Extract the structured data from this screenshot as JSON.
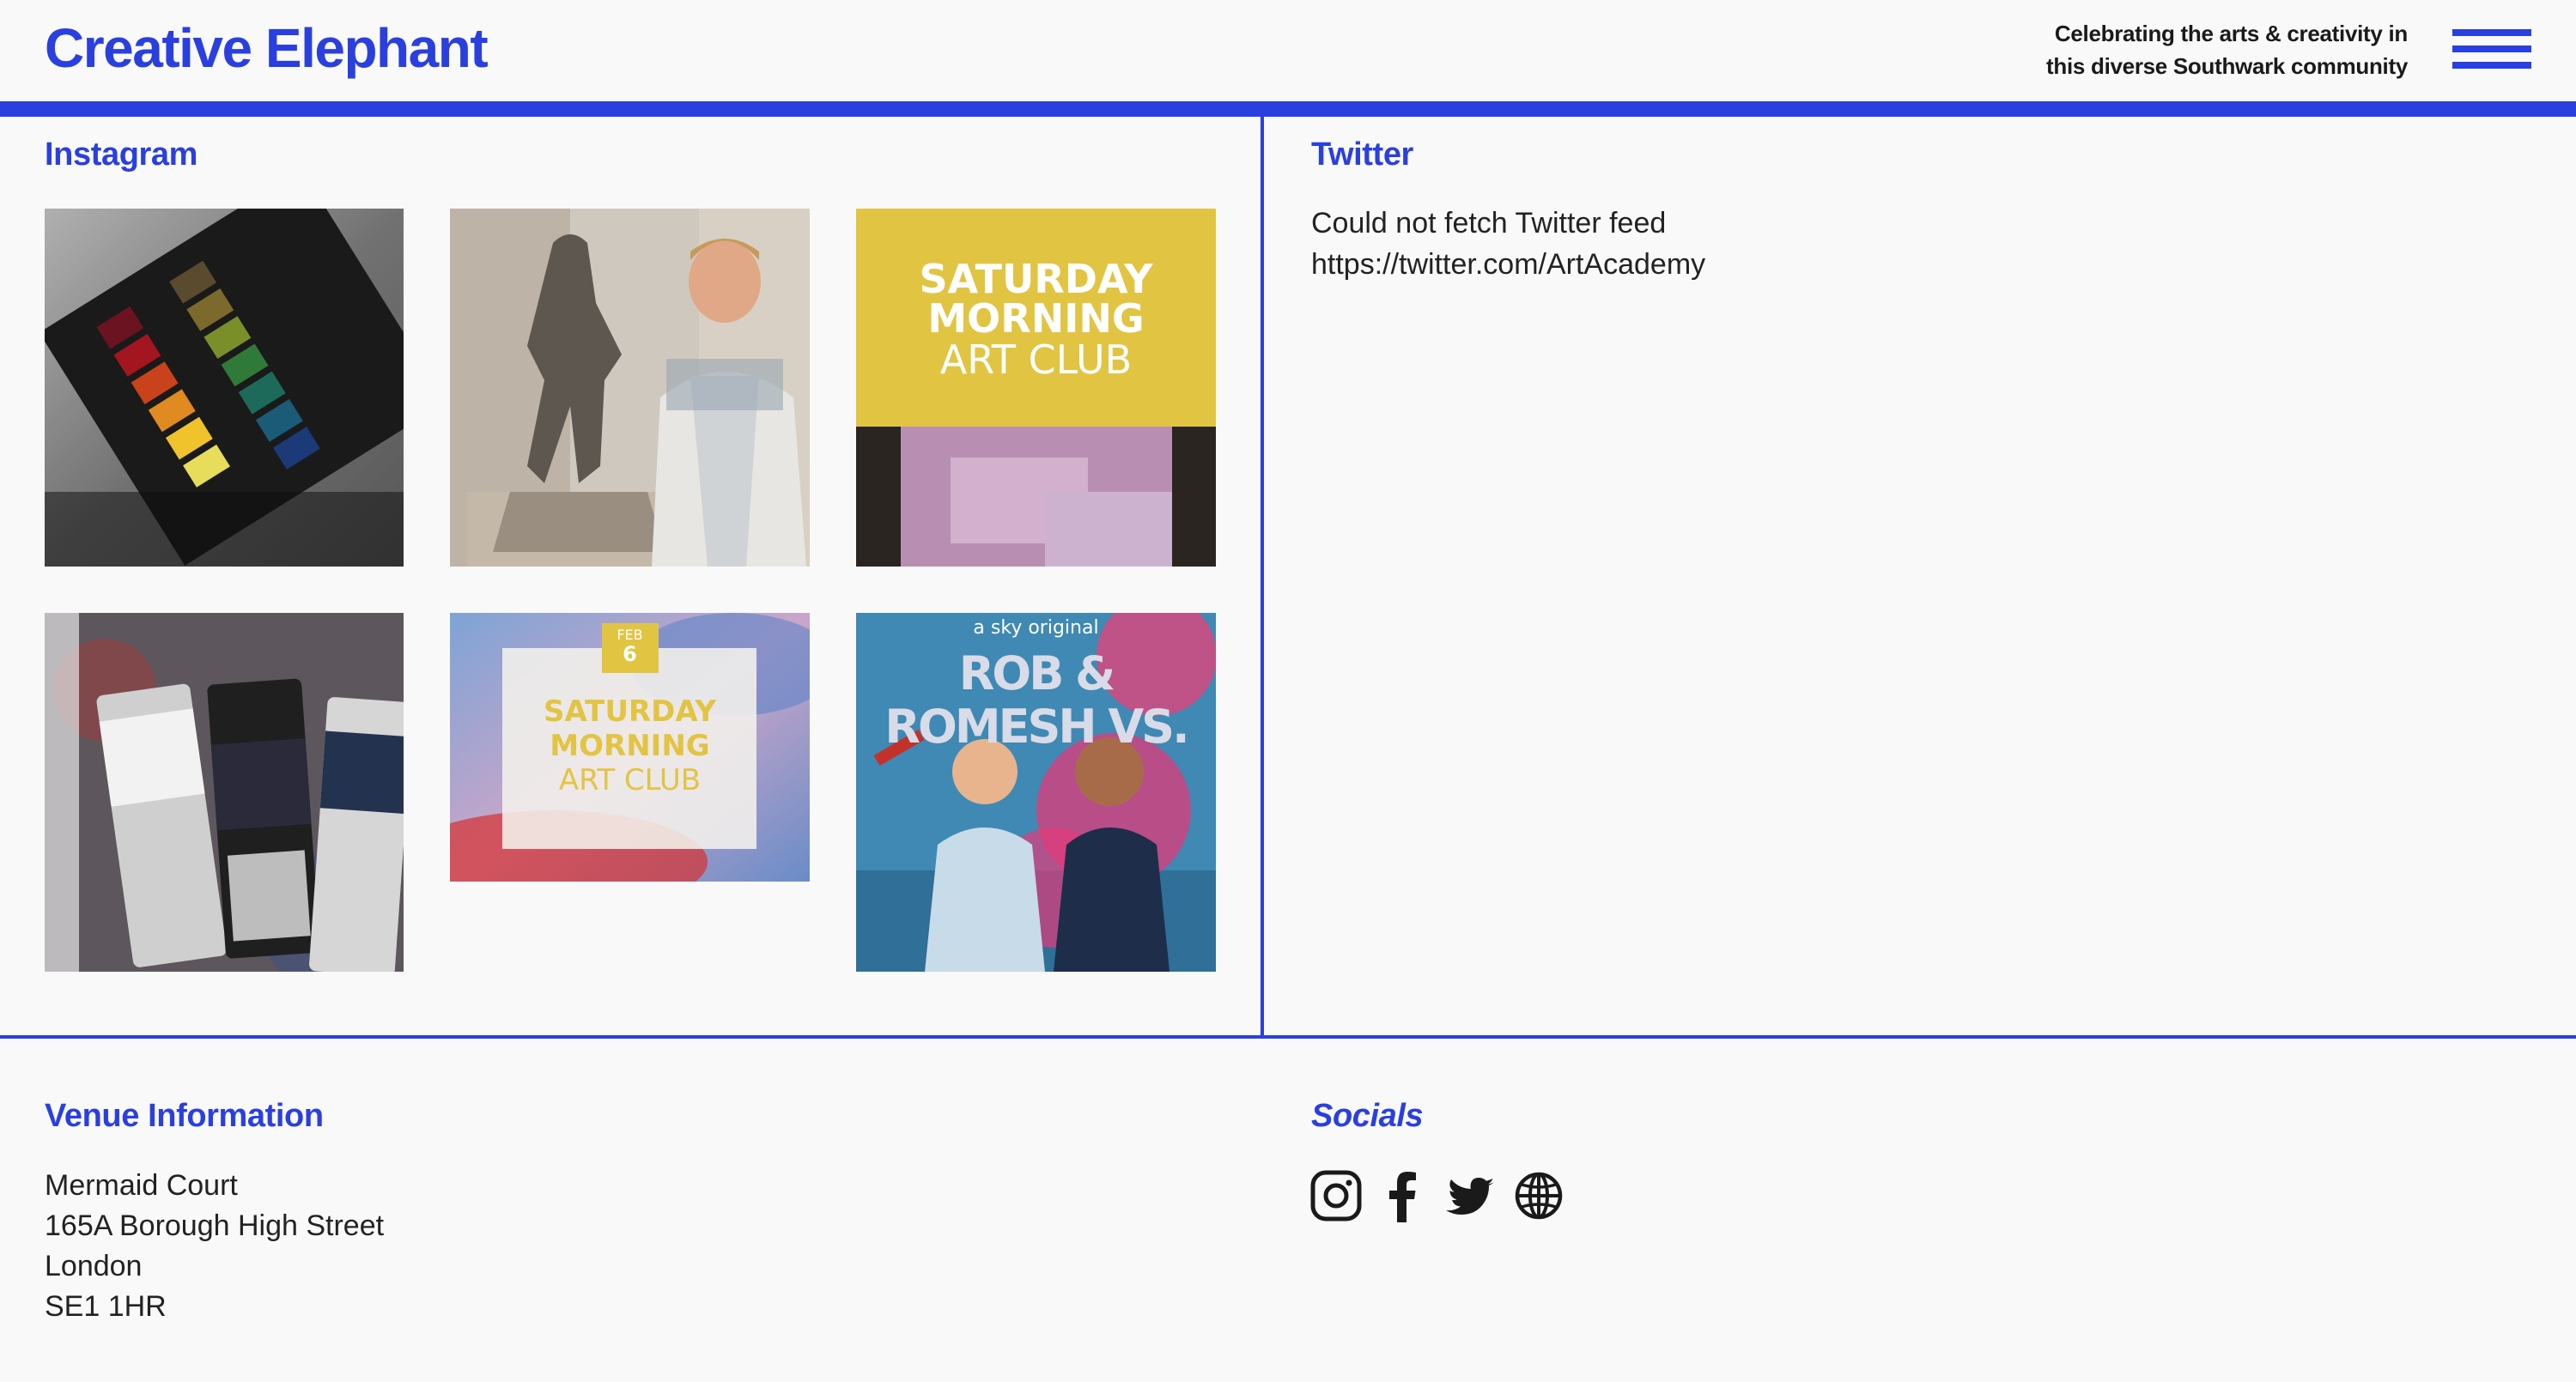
{
  "header": {
    "logo": "Creative Elephant",
    "tagline_line1": "Celebrating the arts & creativity in",
    "tagline_line2": "this diverse Southwark community",
    "menu_icon": "hamburger-menu-icon"
  },
  "colors": {
    "accent": "#2a3fe0",
    "background": "#f9f9f9",
    "text": "#1a1a1a",
    "art_club_yellow": "#e2c443"
  },
  "instagram": {
    "heading": "Instagram",
    "posts": [
      {
        "alt": "Watercolour paint palette"
      },
      {
        "alt": "Artist with clay sculpture"
      },
      {
        "line1": "SATURDAY",
        "line2": "MORNING",
        "line3": "ART CLUB"
      },
      {
        "alt": "Oil paint tubes"
      },
      {
        "month": "FEB",
        "day": "6",
        "line1": "SATURDAY",
        "line2": "MORNING",
        "line3": "ART CLUB"
      },
      {
        "tag": "a sky original",
        "title": "ROB & ROMESH VS."
      }
    ]
  },
  "twitter": {
    "heading": "Twitter",
    "message": "Could not fetch Twitter feed",
    "url": "https://twitter.com/ArtAcademy"
  },
  "venue": {
    "heading": "Venue Information",
    "address": [
      "Mermaid Court",
      "165A Borough High Street",
      "London",
      "SE1 1HR"
    ]
  },
  "socials": {
    "heading": "Socials",
    "icons": [
      "instagram-icon",
      "facebook-icon",
      "twitter-icon",
      "website-globe-icon"
    ]
  }
}
